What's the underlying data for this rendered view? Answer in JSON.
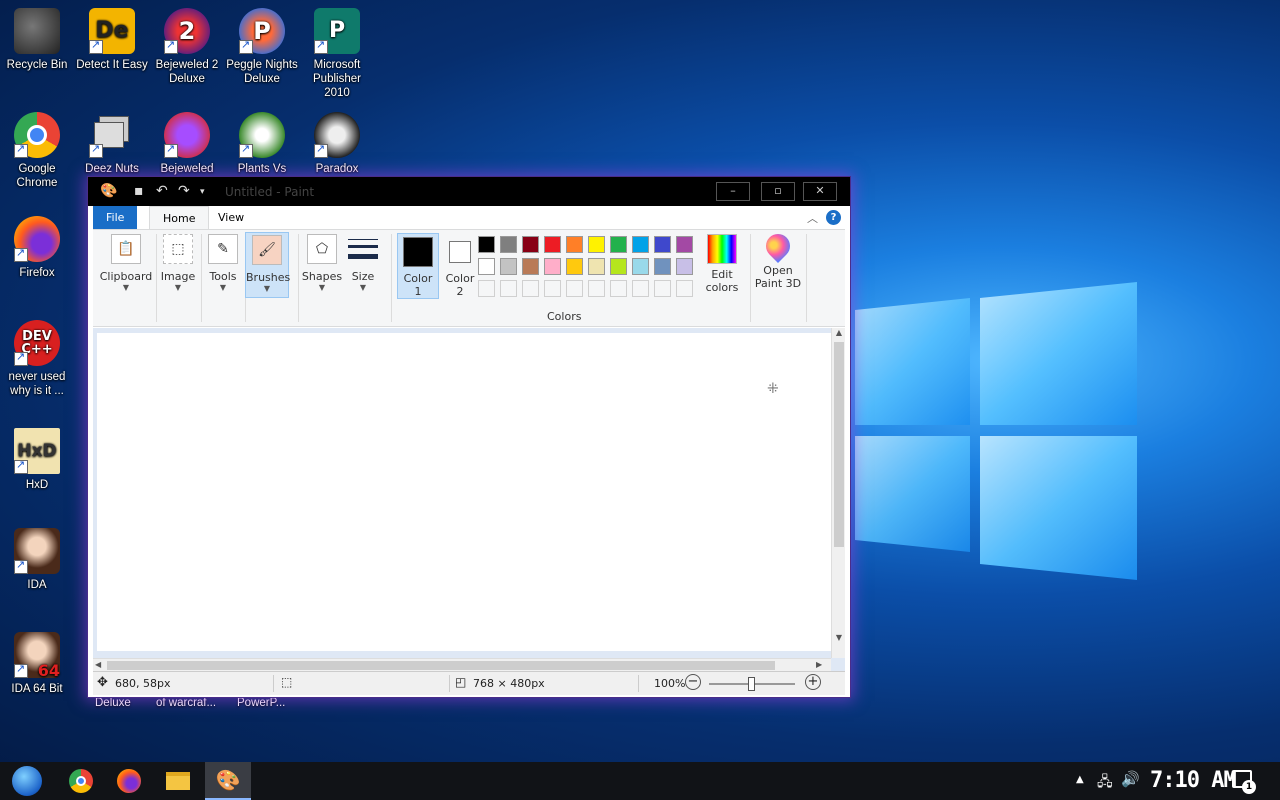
{
  "desktop": {
    "icons": [
      {
        "label": "Recycle Bin"
      },
      {
        "label": "Detect It Easy"
      },
      {
        "label": "Bejeweled 2 Deluxe"
      },
      {
        "label": "Peggle Nights Deluxe"
      },
      {
        "label": "Microsoft Publisher 2010"
      },
      {
        "label": "Google Chrome"
      },
      {
        "label": "Deez Nuts Spy"
      },
      {
        "label": "Bejeweled"
      },
      {
        "label": "Plants Vs"
      },
      {
        "label": "Paradox"
      },
      {
        "label": "Firefox"
      },
      {
        "label": "never used why is it ..."
      },
      {
        "label": "HxD"
      },
      {
        "label": "IDA"
      },
      {
        "label": "IDA 64 Bit"
      }
    ],
    "partial_labels": [
      "Deluxe",
      "of warcraf...",
      "PowerP..."
    ]
  },
  "paint": {
    "title": "Untitled - Paint",
    "tabs": {
      "file": "File",
      "home": "Home",
      "view": "View"
    },
    "ribbon": {
      "clipboard": "Clipboard",
      "image": "Image",
      "tools": "Tools",
      "brushes": "Brushes",
      "shapes": "Shapes",
      "size": "Size",
      "color1_a": "Color",
      "color1_b": "1",
      "color2_a": "Color",
      "color2_b": "2",
      "colors": "Colors",
      "edit_colors_a": "Edit",
      "edit_colors_b": "colors",
      "open_paint3d_a": "Open",
      "open_paint3d_b": "Paint 3D"
    },
    "palette_row1": [
      "#000000",
      "#7f7f7f",
      "#880015",
      "#ed1c24",
      "#ff7f27",
      "#fff200",
      "#22b14c",
      "#00a2e8",
      "#3f48cc",
      "#a349a4"
    ],
    "palette_row2": [
      "#ffffff",
      "#c3c3c3",
      "#b97a57",
      "#ffaec9",
      "#ffc90e",
      "#efe4b0",
      "#b5e61d",
      "#99d9ea",
      "#7092be",
      "#c8bfe7"
    ],
    "status": {
      "cursor_pos": "680, 58px",
      "canvas_size": "768 × 480px",
      "zoom": "100%"
    }
  },
  "taskbar": {
    "clock": "7:10 AM",
    "notification_count": "1"
  }
}
